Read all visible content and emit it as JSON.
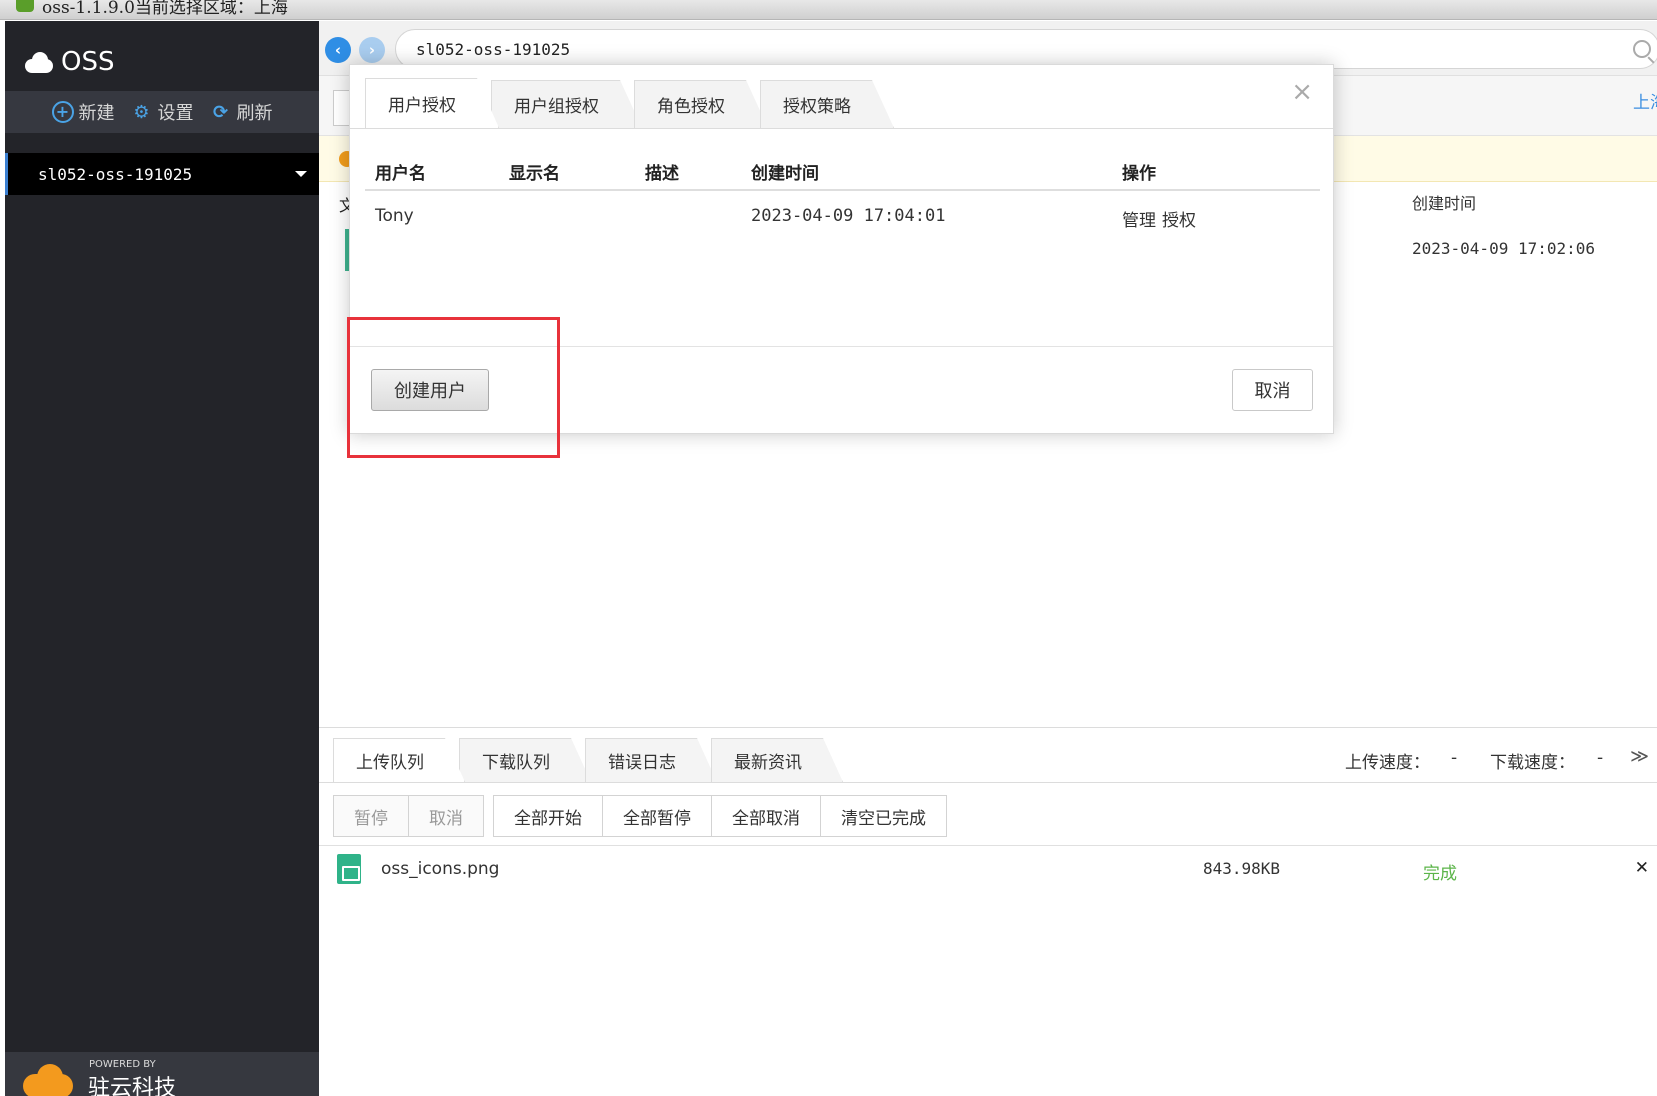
{
  "window": {
    "title": "oss-1.1.9.0当前选择区域：上海"
  },
  "sidebar": {
    "brand": "OSS",
    "toolbar": {
      "new_label": "新建",
      "settings_label": "设置",
      "refresh_label": "刷新"
    },
    "bucket_name": "sl052-oss-191025",
    "powered_by": "POWERED BY",
    "company": "驻云科技"
  },
  "addressbar": {
    "path": "sl052-oss-191025"
  },
  "background": {
    "region_link": "上海",
    "file_col_head": "文件名",
    "created_label": "创建时间",
    "created_value": "2023-04-09 17:02:06"
  },
  "modal": {
    "tabs": [
      "用户授权",
      "用户组授权",
      "角色授权",
      "授权策略"
    ],
    "active_tab": 0,
    "columns": {
      "username": "用户名",
      "display_name": "显示名",
      "description": "描述",
      "created": "创建时间",
      "actions": "操作"
    },
    "rows": [
      {
        "username": "Tony",
        "display_name": "",
        "description": "",
        "created": "2023-04-09 17:04:01",
        "manage_label": "管理",
        "authorize_label": "授权"
      }
    ],
    "create_user_label": "创建用户",
    "cancel_label": "取消",
    "close_symbol": "×"
  },
  "transfer": {
    "tabs": [
      "上传队列",
      "下载队列",
      "错误日志",
      "最新资讯"
    ],
    "active_tab": 0,
    "upload_speed_label": "上传速度：",
    "upload_speed_value": "-",
    "download_speed_label": "下载速度：",
    "download_speed_value": "-",
    "actions": [
      "暂停",
      "取消",
      "全部开始",
      "全部暂停",
      "全部取消",
      "清空已完成"
    ],
    "files": [
      {
        "name": "oss_icons.png",
        "size": "843.98KB",
        "status": "完成"
      }
    ]
  },
  "colors": {
    "sidebar_bg": "#232429",
    "accent": "#3a8ee6",
    "highlight": "#e8323b",
    "status_done": "#5cb54a"
  }
}
